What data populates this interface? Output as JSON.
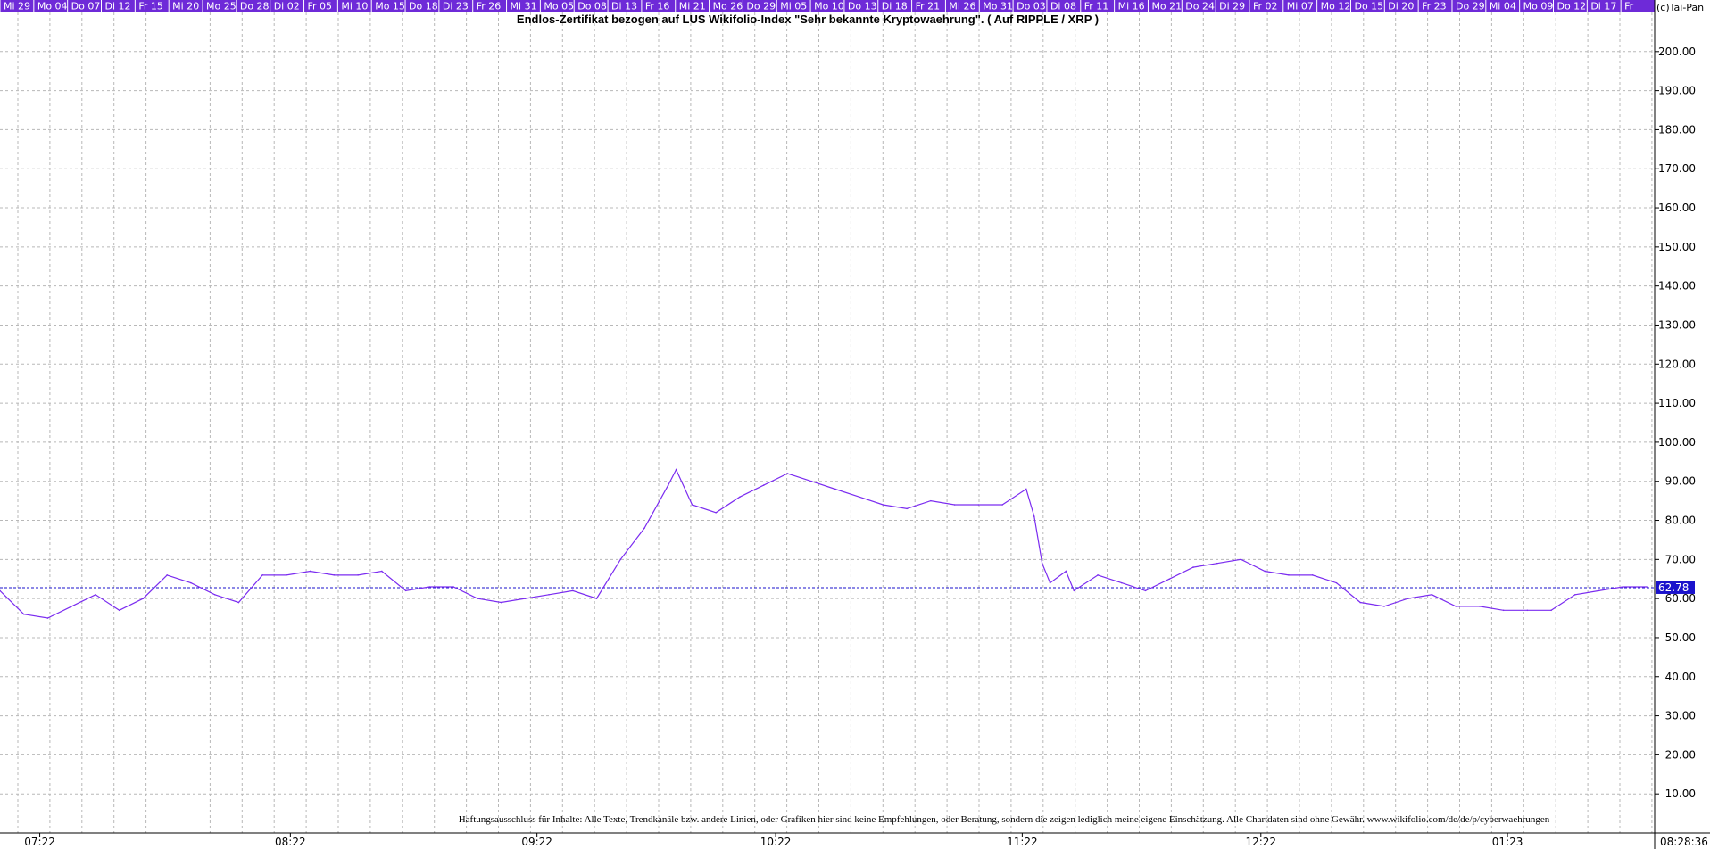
{
  "copyright": "(c)Tai-Pan",
  "timestamp": "08:28:36",
  "disclaimer": "Haftungsausschluss für Inhalte: Alle Texte, Trendkanäle bzw. andere Linien, oder Grafiken hier sind keine Empfehlungen, oder Beratung, sondern die zeigen lediglich meine eigene Einschätzung. Alle Chartdaten sind ohne Gewähr.  www.wikifolio.com/de/de/p/cyberwaehrungen",
  "colors": {
    "line": "#7b2cf0",
    "day_bar": "#6e2ad8",
    "last_price_bg": "#1a12cc",
    "grid": "#b8b8b8"
  },
  "day_labels": [
    "Mi 29",
    "Mo 04",
    "Do 07",
    "Di 12",
    "Fr 15",
    "Mi 20",
    "Mo 25",
    "Do 28",
    "Di 02",
    "Fr 05",
    "Mi 10",
    "Mo 15",
    "Do 18",
    "Di 23",
    "Fr 26",
    "Mi 31",
    "Mo 05",
    "Do 08",
    "Di 13",
    "Fr 16",
    "Mi 21",
    "Mo 26",
    "Do 29",
    "Mi 05",
    "Mo 10",
    "Do 13",
    "Di 18",
    "Fr 21",
    "Mi 26",
    "Mo 31",
    "Do 03",
    "Di 08",
    "Fr 11",
    "Mi 16",
    "Mo 21",
    "Do 24",
    "Di 29",
    "Fr 02",
    "Mi 07",
    "Mo 12",
    "Do 15",
    "Di 20",
    "Fr 23",
    "Do 29",
    "Mi 04",
    "Mo 09",
    "Do 12",
    "Di 17",
    "Fr"
  ],
  "chart_data": {
    "type": "line",
    "title": "Endlos-Zertifikat bezogen auf LUS Wikifolio-Index \"Sehr bekannte Kryptowaehrung\". ( Auf RIPPLE / XRP )",
    "xlabel": "",
    "ylabel": "",
    "ylim": [
      0,
      210
    ],
    "yticks": [
      "10.00",
      "20.00",
      "30.00",
      "40.00",
      "50.00",
      "60.00",
      "70.00",
      "80.00",
      "90.00",
      "100.00",
      "110.00",
      "120.00",
      "130.00",
      "140.00",
      "150.00",
      "160.00",
      "170.00",
      "180.00",
      "190.00",
      "200.00"
    ],
    "x_month_labels": [
      "07:22",
      "08:22",
      "09:22",
      "10:22",
      "11:22",
      "12:22",
      "01:23"
    ],
    "x_range": [
      0,
      208
    ],
    "month_positions": [
      5,
      36.5,
      67.5,
      97.5,
      128.5,
      158.5,
      189.5
    ],
    "last_value": 62.78,
    "last_value_label": "62.78",
    "legend": "none",
    "grid": true,
    "series": [
      {
        "x": [
          0,
          3,
          6,
          9,
          12,
          15,
          18,
          21,
          24,
          27,
          30,
          33,
          36,
          39,
          42,
          45,
          48,
          51,
          54,
          57,
          60,
          63,
          66,
          69,
          72,
          75,
          78,
          81,
          84,
          85,
          87,
          90,
          93,
          96,
          99,
          102,
          105,
          108,
          111,
          114,
          117,
          120,
          123,
          126,
          129,
          130,
          131,
          132,
          134,
          135,
          138,
          141,
          144,
          147,
          150,
          153,
          156,
          159,
          162,
          165,
          168,
          171,
          174,
          177,
          180,
          183,
          186,
          189,
          192,
          195,
          198,
          201,
          204,
          207
        ],
        "values": [
          62,
          56,
          55,
          58,
          61,
          57,
          60,
          66,
          64,
          61,
          59,
          66,
          66,
          67,
          66,
          66,
          67,
          62,
          63,
          63,
          60,
          59,
          60,
          61,
          62,
          60,
          70,
          78,
          89,
          93,
          84,
          82,
          86,
          89,
          92,
          90,
          88,
          86,
          84,
          83,
          85,
          84,
          84,
          84,
          88,
          81,
          69,
          64,
          67,
          62,
          66,
          64,
          62,
          65,
          68,
          69,
          70,
          67,
          66,
          66,
          64,
          59,
          58,
          60,
          61,
          58,
          58,
          57,
          57,
          57,
          61,
          62,
          63,
          63
        ]
      }
    ]
  }
}
